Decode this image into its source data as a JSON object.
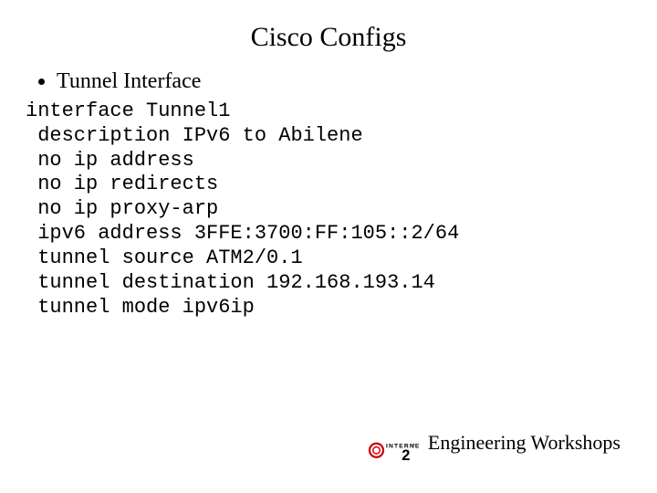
{
  "title": "Cisco Configs",
  "bullet": "Tunnel Interface",
  "code": {
    "l1": "interface Tunnel1",
    "l2": " description IPv6 to Abilene",
    "l3": " no ip address",
    "l4": " no ip redirects",
    "l5": " no ip proxy-arp",
    "l6": " ipv6 address 3FFE:3700:FF:105::2/64",
    "l7": " tunnel source ATM2/0.1",
    "l8": " tunnel destination 192.168.193.14",
    "l9": " tunnel mode ipv6ip"
  },
  "footer": {
    "label": "Engineering Workshops"
  }
}
